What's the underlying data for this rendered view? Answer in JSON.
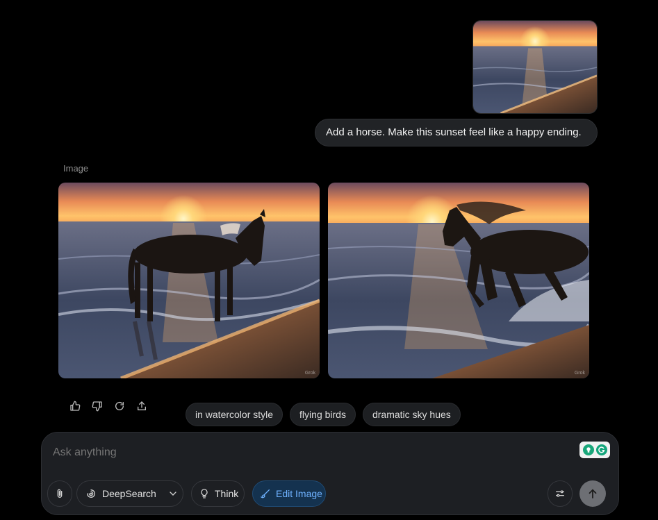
{
  "user_message": {
    "text": "Add a horse. Make this sunset feel like a happy ending.",
    "attachment_icon": "sunset-photo"
  },
  "response": {
    "label": "Image",
    "images": [
      {
        "icon": "horse-standing-beach-sunset",
        "watermark": "Grok"
      },
      {
        "icon": "horse-galloping-surf-sunset",
        "watermark": "Grok"
      }
    ],
    "actions": [
      {
        "icon": "thumbs-up-icon"
      },
      {
        "icon": "thumbs-down-icon"
      },
      {
        "icon": "regenerate-icon"
      },
      {
        "icon": "share-icon"
      }
    ]
  },
  "suggestions": [
    "in watercolor style",
    "flying birds",
    "dramatic sky hues"
  ],
  "composer": {
    "placeholder": "Ask anything",
    "tools": {
      "deepsearch": "DeepSearch",
      "think": "Think",
      "edit_image": "Edit Image"
    }
  },
  "colors": {
    "background": "#000000",
    "accent": "#6fb2ff",
    "bubble": "#212326"
  }
}
